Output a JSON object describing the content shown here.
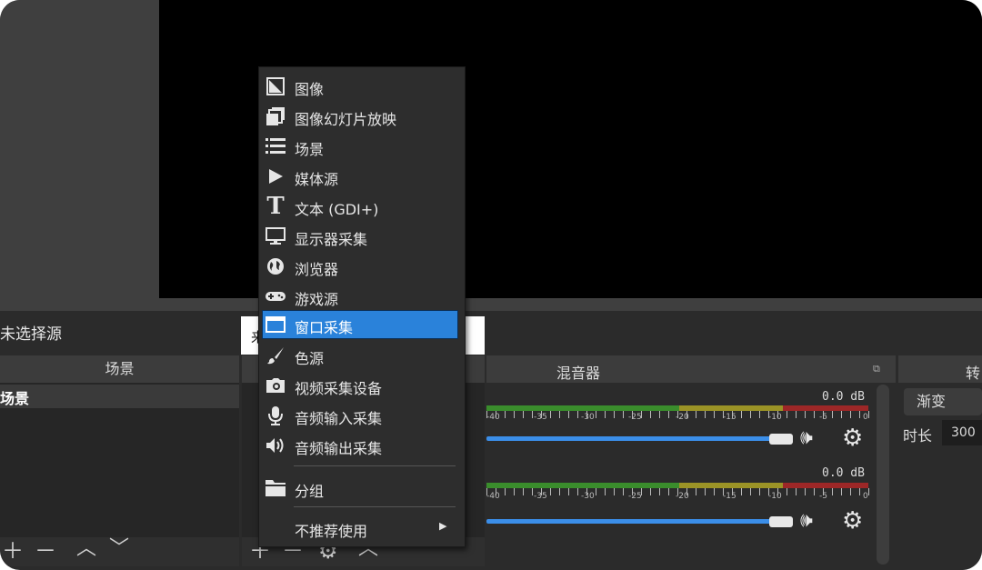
{
  "source_bar": {
    "no_source": "未选择源",
    "props_partial": "来"
  },
  "panels": {
    "scenes": "场景",
    "mixer": "混音器",
    "transitions_partial": "转"
  },
  "scene_list": {
    "items": [
      "场景"
    ]
  },
  "context_menu": {
    "items": [
      {
        "icon": "image-icon",
        "label": "图像"
      },
      {
        "icon": "slideshow-icon",
        "label": "图像幻灯片放映"
      },
      {
        "icon": "scene-list-icon",
        "label": "场景"
      },
      {
        "icon": "play-icon",
        "label": "媒体源"
      },
      {
        "icon": "text-icon",
        "label": "文本 (GDI+)"
      },
      {
        "icon": "monitor-icon",
        "label": "显示器采集"
      },
      {
        "icon": "globe-icon",
        "label": "浏览器"
      },
      {
        "icon": "gamepad-icon",
        "label": "游戏源"
      },
      {
        "icon": "window-icon",
        "label": "窗口采集",
        "selected": true
      },
      {
        "icon": "brush-icon",
        "label": "色源"
      },
      {
        "icon": "camera-icon",
        "label": "视频采集设备"
      },
      {
        "icon": "microphone-icon",
        "label": "音频输入采集"
      },
      {
        "icon": "speaker-icon",
        "label": "音频输出采集"
      },
      {
        "icon": "folder-icon",
        "label": "分组"
      },
      {
        "icon": "none",
        "label": "不推荐使用"
      }
    ]
  },
  "mixer": {
    "channels": [
      {
        "db": "0.0 dB",
        "volume": 1.0
      },
      {
        "db": "0.0 dB",
        "volume": 1.0
      }
    ],
    "tick_labels": [
      "-40",
      "-35",
      "-30",
      "-25",
      "-20",
      "-15",
      "-10",
      "-5",
      "0"
    ]
  },
  "transitions": {
    "type": "渐变",
    "duration_label": "时长",
    "duration_value": "300"
  },
  "colors": {
    "accent": "#2a82da",
    "meter_green": "#3a8d2c",
    "meter_yellow": "#9b9326",
    "meter_red": "#9d2727",
    "slider": "#3b8ee8"
  }
}
